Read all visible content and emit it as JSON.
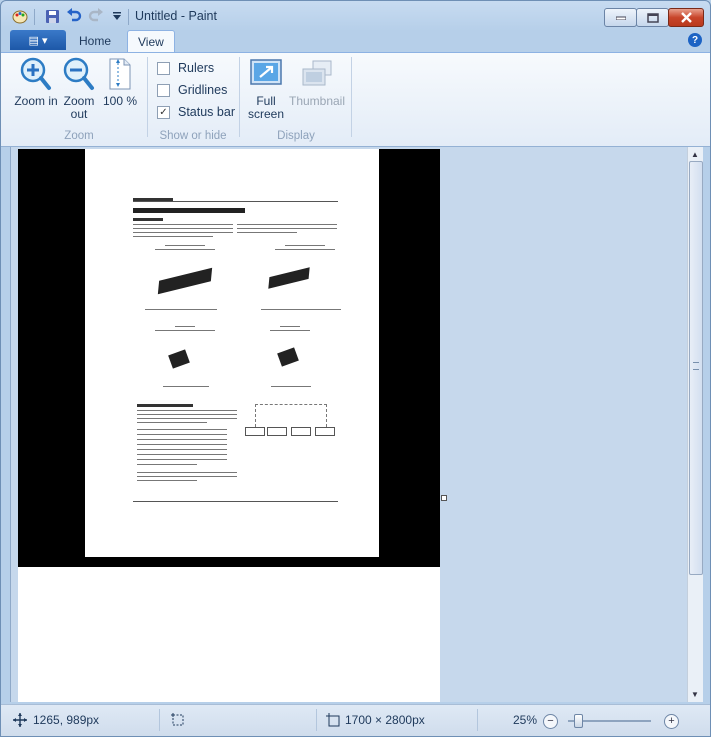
{
  "app": {
    "title": "Untitled - Paint"
  },
  "quick_access": {
    "icons": [
      "paint-app-icon",
      "save-icon",
      "undo-icon",
      "redo-icon",
      "customize-dropdown-icon"
    ]
  },
  "tabs": {
    "file_label": "▤ ▾",
    "home": "Home",
    "view": "View",
    "active": "View"
  },
  "ribbon": {
    "zoom": {
      "label": "Zoom",
      "zoom_in": "Zoom in",
      "zoom_out": "Zoom out",
      "zoom_100": "100 %"
    },
    "show_or_hide": {
      "label": "Show or hide",
      "rulers": {
        "label": "Rulers",
        "checked": false
      },
      "gridlines": {
        "label": "Gridlines",
        "checked": false
      },
      "status_bar": {
        "label": "Status bar",
        "checked": true
      }
    },
    "display": {
      "label": "Display",
      "full_screen": "Full screen",
      "thumbnail": "Thumbnail"
    }
  },
  "statusbar": {
    "cursor_position": "1265, 989px",
    "selection_size": "",
    "image_size": "1700 × 2800px",
    "zoom_level": "25%",
    "zoom_fraction": 0.25
  },
  "colors": {
    "accent": "#1d58a8",
    "close": "#c8452a"
  }
}
